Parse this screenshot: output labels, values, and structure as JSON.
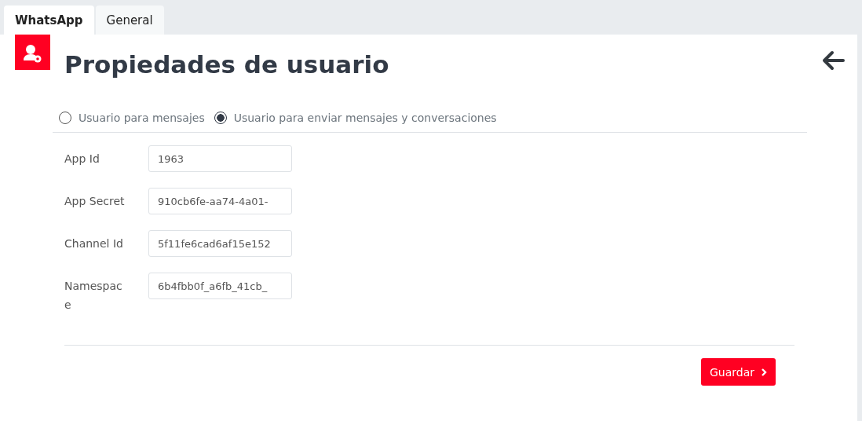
{
  "tabs": [
    {
      "label": "WhatsApp",
      "selected": true
    },
    {
      "label": "General",
      "selected": false
    }
  ],
  "page": {
    "title": "Propiedades de usuario"
  },
  "user_type": [
    {
      "label": "Usuario para mensajes",
      "selected": false
    },
    {
      "label": "Usuario para enviar mensajes y conversaciones",
      "selected": true
    }
  ],
  "fields": [
    {
      "label": "App Id",
      "value": "1963"
    },
    {
      "label": "App Secret",
      "value": "910cb6fe-aa74-4a01-"
    },
    {
      "label": "Channel Id",
      "value": "5f11fe6cad6af15e152"
    },
    {
      "label": "Namespace",
      "value": "6b4fbb0f_a6fb_41cb_"
    }
  ],
  "buttons": [
    {
      "label": "Guardar"
    }
  ]
}
